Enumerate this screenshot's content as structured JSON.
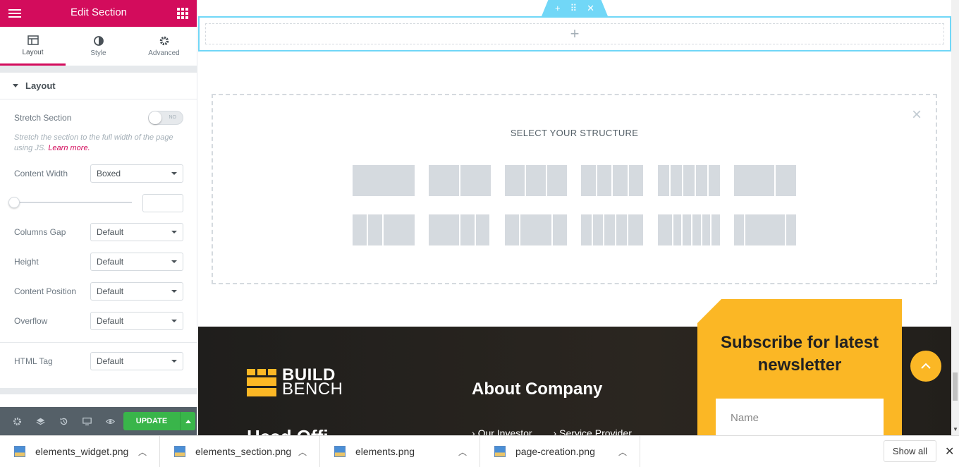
{
  "panel": {
    "title": "Edit Section",
    "tabs": [
      {
        "label": "Layout",
        "icon": "layout-icon"
      },
      {
        "label": "Style",
        "icon": "half-circle-icon"
      },
      {
        "label": "Advanced",
        "icon": "gear-icon"
      }
    ],
    "section_heading": "Layout",
    "stretch_label": "Stretch Section",
    "stretch_toggle": "NO",
    "stretch_desc": "Stretch the section to the full width of the page using JS.",
    "learn_more": "Learn more.",
    "content_width_label": "Content Width",
    "content_width_value": "Boxed",
    "columns_gap_label": "Columns Gap",
    "columns_gap_value": "Default",
    "height_label": "Height",
    "height_value": "Default",
    "content_position_label": "Content Position",
    "content_position_value": "Default",
    "overflow_label": "Overflow",
    "overflow_value": "Default",
    "html_tag_label": "HTML Tag",
    "html_tag_value": "Default",
    "update_label": "UPDATE"
  },
  "canvas": {
    "add_symbol": "+",
    "structure_title": "SELECT YOUR STRUCTURE",
    "close_symbol": "×"
  },
  "site": {
    "logo_line1": "BUILD",
    "logo_line2": "BENCH",
    "about_title": "About Company",
    "link1": "Our Investor",
    "link2": "Service Provider",
    "head_office": "Head Offi",
    "newsletter_title": "Subscribe for latest newsletter",
    "name_placeholder": "Name"
  },
  "downloads": {
    "files": [
      "elements_widget.png",
      "elements_section.png",
      "elements.png",
      "page-creation.png"
    ],
    "show_all": "Show all"
  },
  "colors": {
    "accent": "#d30c5c",
    "update": "#39b54a",
    "brand_yellow": "#fbb725",
    "handle": "#71d7f7"
  }
}
